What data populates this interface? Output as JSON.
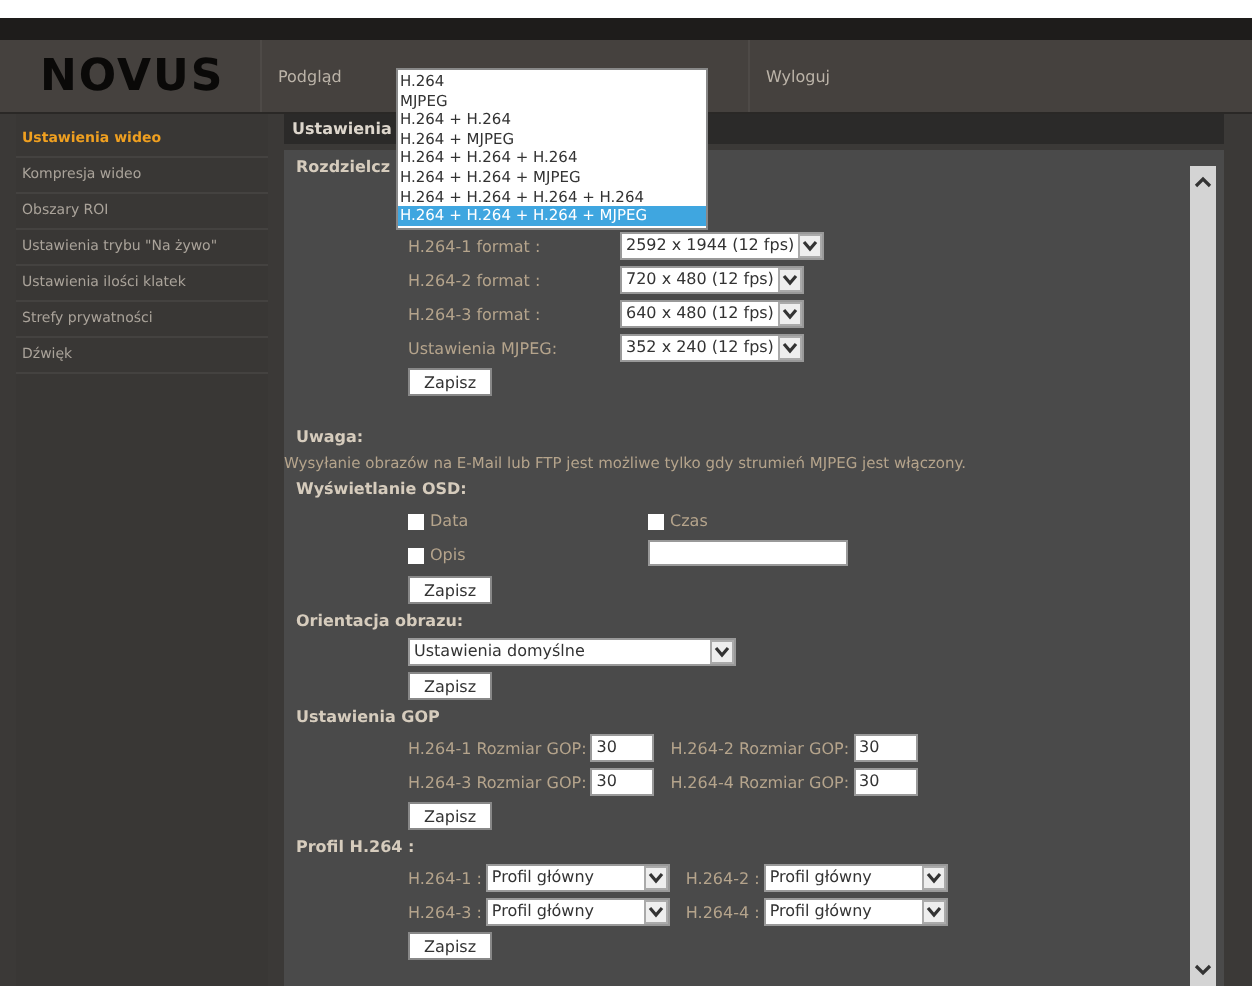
{
  "header": {
    "logo": "NOVUS",
    "nav": [
      "Podgląd",
      "Wyloguj"
    ]
  },
  "stream_dropdown": {
    "options": [
      {
        "label": "H.264",
        "selected": false
      },
      {
        "label": "MJPEG",
        "selected": false
      },
      {
        "label": "H.264 + H.264",
        "selected": false
      },
      {
        "label": "H.264 + MJPEG",
        "selected": false
      },
      {
        "label": "H.264 + H.264 + H.264",
        "selected": false
      },
      {
        "label": "H.264 + H.264 + MJPEG",
        "selected": false
      },
      {
        "label": "H.264 + H.264 + H.264 + H.264",
        "selected": false
      },
      {
        "label": "H.264 + H.264 + H.264 + MJPEG",
        "selected": true
      }
    ]
  },
  "sidebar": {
    "items": [
      {
        "label": "Ustawienia wideo",
        "selected": true
      },
      {
        "label": "Kompresja wideo",
        "selected": false
      },
      {
        "label": "Obszary ROI",
        "selected": false
      },
      {
        "label": "Ustawienia trybu \"Na żywo\"",
        "selected": false
      },
      {
        "label": "Ustawienia ilości klatek",
        "selected": false
      },
      {
        "label": "Strefy prywatności",
        "selected": false
      },
      {
        "label": "Dźwięk",
        "selected": false
      }
    ]
  },
  "content": {
    "title": "Ustawienia",
    "resolution_label": "Rozdzielcz",
    "formats": [
      {
        "label": "H.264-1 format :",
        "value": "2592 x 1944 (12 fps)"
      },
      {
        "label": "H.264-2 format :",
        "value": "720 x 480 (12 fps)"
      },
      {
        "label": "H.264-3 format :",
        "value": "640 x 480 (12 fps)"
      },
      {
        "label": "Ustawienia MJPEG:",
        "value": "352 x 240 (12 fps)"
      }
    ],
    "note_title": "Uwaga:",
    "note_text": "Wysyłanie obrazów na E-Mail lub FTP jest możliwe tylko gdy strumień MJPEG jest włączony.",
    "osd": {
      "heading": "Wyświetlanie OSD:",
      "options": [
        {
          "label": "Data",
          "checked": false
        },
        {
          "label": "Czas",
          "checked": false
        },
        {
          "label": "Opis",
          "checked": false
        }
      ]
    },
    "orientation": {
      "heading": "Orientacja obrazu:",
      "value": "Ustawienia domyślne"
    },
    "gop": {
      "heading": "Ustawienia GOP",
      "fields": [
        {
          "label": "H.264-1 Rozmiar GOP:",
          "value": "30"
        },
        {
          "label": "H.264-2 Rozmiar GOP:",
          "value": "30"
        },
        {
          "label": "H.264-3 Rozmiar GOP:",
          "value": "30"
        },
        {
          "label": "H.264-4 Rozmiar GOP:",
          "value": "30"
        }
      ]
    },
    "profile": {
      "heading": "Profil H.264 :",
      "fields": [
        {
          "label": "H.264-1 :",
          "value": "Profil główny"
        },
        {
          "label": "H.264-2 :",
          "value": "Profil główny"
        },
        {
          "label": "H.264-3 :",
          "value": "Profil główny"
        },
        {
          "label": "H.264-4 :",
          "value": "Profil główny"
        }
      ]
    },
    "save_buttons": [
      "Zapisz",
      "Zapisz",
      "Zapisz",
      "Zapisz",
      "Zapisz"
    ]
  }
}
